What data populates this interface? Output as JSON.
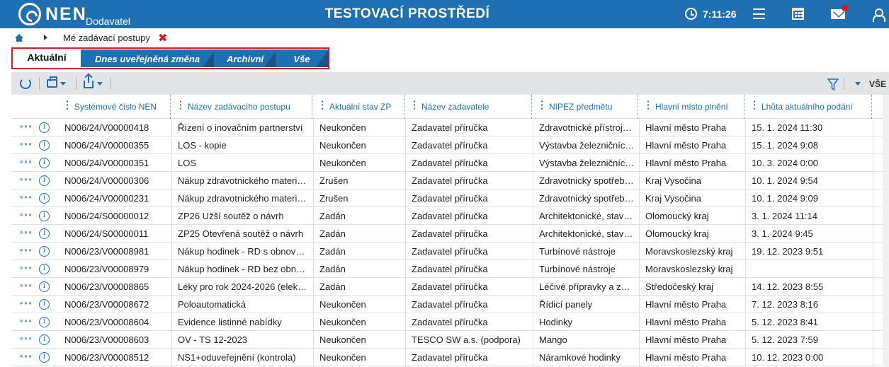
{
  "header": {
    "brand": "NEN",
    "brand_sub": "Dodavatel",
    "environment": "TESTOVACÍ PROSTŘEDÍ",
    "time": "7:11:26",
    "icons": [
      "logo-icon",
      "clock-icon",
      "menu-icon",
      "calendar-icon",
      "mail-icon",
      "user-icon"
    ],
    "notification_color": "#e2131b",
    "brand_color": "#1f6fb4"
  },
  "breadcrumb": {
    "current": "Mé zadávací postupy",
    "close": "✖"
  },
  "tabs": [
    {
      "label": "Aktuální",
      "active": true
    },
    {
      "label": "Dnes uveřejněná změna",
      "active": false
    },
    {
      "label": "Archivní",
      "active": false
    },
    {
      "label": "Vše",
      "active": false
    }
  ],
  "toolbar": {
    "scope_label": "VŠE",
    "icons": [
      "refresh-icon",
      "print-icon",
      "export-icon",
      "filter-icon"
    ]
  },
  "table": {
    "columns": [
      "Systémové číslo NEN",
      "Název zadávacího postupu",
      "Aktuální stav ZP",
      "Název zadavatele",
      "NIPEZ předmětu",
      "Hlavní místo plnění",
      "Lhůta aktuálního podání"
    ],
    "rows": [
      [
        "N006/24/V00000418",
        "Řízení o inovačním partnerství",
        "Neukončen",
        "Zadavatel příručka",
        "Zdravotnické přístroj…",
        "Hlavní město Praha",
        "15. 1. 2024 11:30"
      ],
      [
        "N006/24/V00000355",
        "LOS - kopie",
        "Neukončen",
        "Zadavatel příručka",
        "Výstavba železničníc…",
        "Hlavní město Praha",
        "15. 1. 2024 9:08"
      ],
      [
        "N006/24/V00000351",
        "LOS",
        "Neukončen",
        "Zadavatel příručka",
        "Výstavba železničníc…",
        "Hlavní město Praha",
        "10. 3. 2024 0:00"
      ],
      [
        "N006/24/V00000306",
        "Nákup zdravotnického materi…",
        "Zrušen",
        "Zadavatel příručka",
        "Zdravotnický spotřeb…",
        "Kraj Vysočina",
        "10. 1. 2024 9:54"
      ],
      [
        "N006/24/V00000231",
        "Nákup zdravotnického materi…",
        "Zrušen",
        "Zadavatel příručka",
        "Zdravotnický spotřeb…",
        "Kraj Vysočina",
        "10. 1. 2024 9:09"
      ],
      [
        "N006/24/S00000012",
        "ZP26 Užší soutěž o návrh",
        "Zadán",
        "Zadavatel příručka",
        "Architektonické, stav…",
        "Olomoucký kraj",
        "3. 1. 2024 11:14"
      ],
      [
        "N006/24/S00000011",
        "ZP25 Otevřená soutěž o návrh",
        "Zadán",
        "Zadavatel příručka",
        "Architektonické, stav…",
        "Olomoucký kraj",
        "3. 1. 2024 9:45"
      ],
      [
        "N006/23/V00008981",
        "Nákup hodinek - RD s obnove…",
        "Zadán",
        "Zadavatel příručka",
        "Turbínové nástroje",
        "Moravskoslezský kraj",
        "19. 12. 2023 9:51"
      ],
      [
        "N006/23/V00008979",
        "Nákup hodinek - RD bez obno…",
        "Zadán",
        "Zadavatel příručka",
        "Turbínové nástroje",
        "Moravskoslezský kraj",
        ""
      ],
      [
        "N006/23/V00008865",
        "Léky pro rok 2024-2026 (elekt…",
        "Zadán",
        "Zadavatel příručka",
        "Léčivé přípravky a zdr…",
        "Středočeský kraj",
        "14. 12. 2023 8:55"
      ],
      [
        "N006/23/V00008672",
        "Poloautomatická",
        "Neukončen",
        "Zadavatel příručka",
        "Řídicí panely",
        "Hlavní město Praha",
        "7. 12. 2023 8:16"
      ],
      [
        "N006/23/V00008604",
        "Evidence listinné nabídky",
        "Neukončen",
        "Zadavatel příručka",
        "Hodinky",
        "Hlavní město Praha",
        "5. 12. 2023 8:41"
      ],
      [
        "N006/23/V00008603",
        "OV - TS 12-2023",
        "Neukončen",
        "TESCO SW a.s. (podpora)",
        "Mango",
        "Hlavní město Praha",
        "5. 12. 2023 7:59"
      ],
      [
        "N006/23/V00008512",
        "NS1+oduveřejnění (kontrola)",
        "Neukončen",
        "Zadavatel příručka",
        "Náramkové hodinky",
        "Hlavní město Praha",
        "10. 12. 2023 0:00"
      ]
    ],
    "row_actions_glyph": "∘∘∘",
    "info_glyph": "i"
  }
}
